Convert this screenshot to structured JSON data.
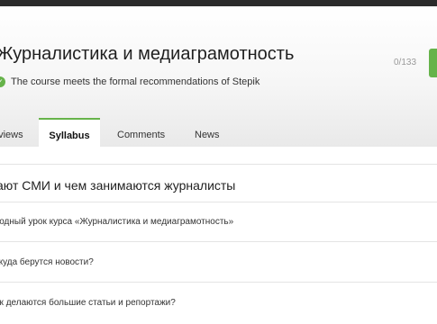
{
  "course": {
    "title": "Журналистика и медиаграмотность",
    "recommendation": "The course meets the formal recommendations of Stepik",
    "progress": "0/133"
  },
  "tabs": [
    {
      "label": "eviews"
    },
    {
      "label": "Syllabus",
      "active": true
    },
    {
      "label": "Comments"
    },
    {
      "label": "News"
    }
  ],
  "syllabus": {
    "section_title": "ают СМИ и чем занимаются журналисты",
    "lessons": [
      {
        "title": "водный урок курса «Журналистика и медиаграмотность»"
      },
      {
        "title": "ткуда берутся новости?"
      },
      {
        "title": "ак делаются большие статьи и репортажи?"
      }
    ]
  },
  "colors": {
    "accent": "#66b34a"
  },
  "icons": {
    "recommendation": "check-circle-icon"
  }
}
